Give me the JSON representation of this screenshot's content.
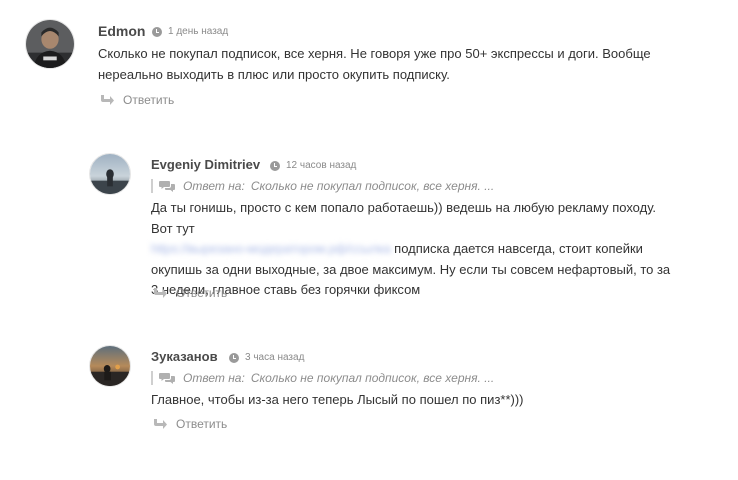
{
  "comments": [
    {
      "author": "Edmon",
      "time": "1 день назад",
      "text": "Сколько не покупал подписок, все херня. Не говоря уже про 50+ экспрессы и доги. Вообще нереально выходить в плюс или просто окупить подписку.",
      "reply_label": "Ответить"
    },
    {
      "author": "Evgeniy Dimitriev",
      "time": "12 часов назад",
      "reply_to_label": "Ответ на:",
      "reply_to_text": "Сколько не покупал подписок, все херня. ...",
      "text_part1": "Да ты гонишь, просто с кем попало работаешь)) ведешь на любую рекламу походу. Вот тут",
      "blurred_link": "https://вырезано-модератором.рф/ссылка",
      "text_part2": " подписка дается навсегда, стоит копейки окупишь за одни выходные, за двое максимум. Ну если ты совсем нефартовый, то за 3 недели, главное ставь без горячки фиксом",
      "reply_label": "Ответить"
    },
    {
      "author": "Зуказанов",
      "time": "3 часа назад",
      "reply_to_label": "Ответ на:",
      "reply_to_text": "Сколько не покупал подписок, все херня. ...",
      "text": "Главное, чтобы из-за него теперь Лысый по пошел по пиз**)))",
      "reply_label": "Ответить"
    }
  ],
  "colors": {
    "author": "#4a4a4a",
    "text": "#333333",
    "muted": "#8c8c8c",
    "blurred_link": "#aebde8"
  }
}
